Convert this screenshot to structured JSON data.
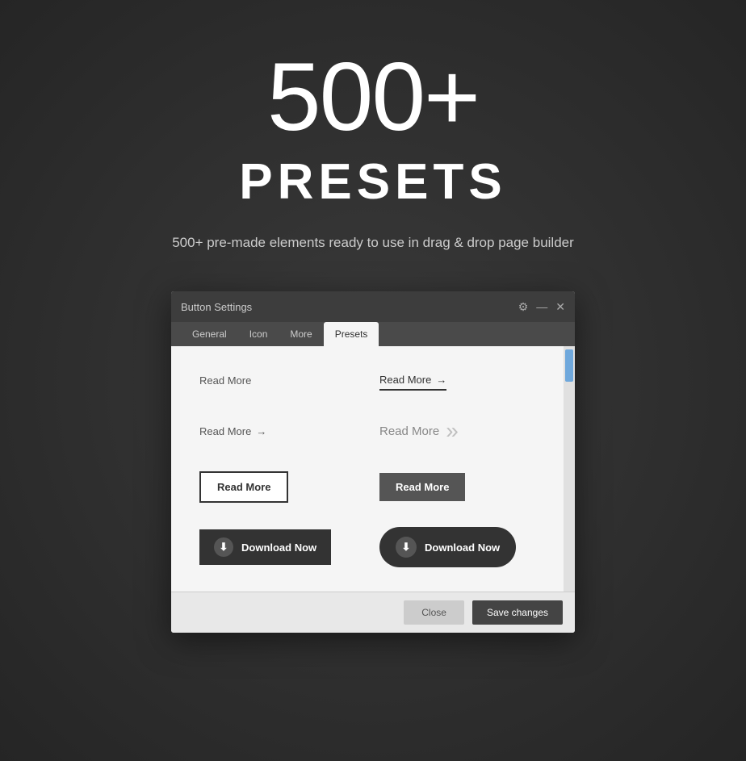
{
  "hero": {
    "number": "500+",
    "title": "PRESETS",
    "subtitle": "500+ pre-made elements ready to use in drag & drop page builder"
  },
  "dialog": {
    "title": "Button Settings",
    "controls": {
      "gear": "⚙",
      "minimize": "—",
      "close": "✕"
    },
    "tabs": [
      {
        "label": "General",
        "active": false
      },
      {
        "label": "Icon",
        "active": false
      },
      {
        "label": "More",
        "active": false
      },
      {
        "label": "Presets",
        "active": true
      }
    ],
    "presets": [
      {
        "id": "plain-text-1",
        "label": "Read More",
        "style": "plain"
      },
      {
        "id": "underline-arrow-1",
        "label": "Read More",
        "style": "underline-arrow"
      },
      {
        "id": "arrow-right-1",
        "label": "Read More",
        "style": "arrow-right"
      },
      {
        "id": "double-arrow-1",
        "label": "Read More",
        "style": "double-arrow"
      },
      {
        "id": "outline-dark-1",
        "label": "Read More",
        "style": "outline-dark"
      },
      {
        "id": "filled-dark-1",
        "label": "Read More",
        "style": "filled-dark"
      },
      {
        "id": "download-light-1",
        "label": "Download Now",
        "style": "download-light"
      },
      {
        "id": "download-dark-1",
        "label": "Download Now",
        "style": "download-dark"
      }
    ],
    "footer": {
      "close_label": "Close",
      "save_label": "Save changes"
    }
  }
}
